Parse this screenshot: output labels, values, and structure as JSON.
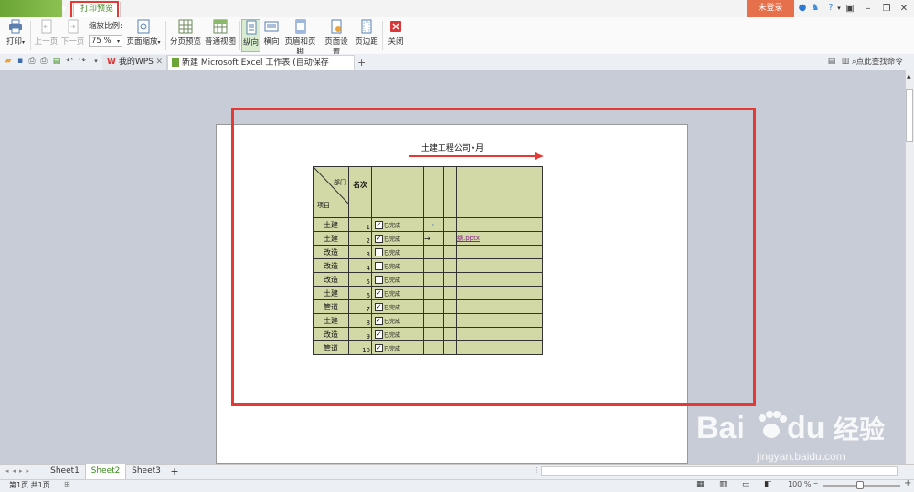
{
  "titlebar": {
    "ribbon_tab": "打印预览",
    "login": "未登录"
  },
  "ribbon": {
    "print": "打印",
    "prev_page": "上一页",
    "next_page": "下一页",
    "zoom_label": "缩放比例:",
    "zoom_value": "75 %",
    "page_zoom": "页面缩放",
    "page_break_preview": "分页预览",
    "normal_view": "普通视图",
    "portrait": "纵向",
    "landscape": "横向",
    "header_footer": "页眉和页脚",
    "page_setup": "页面设置",
    "margins": "页边距",
    "close": "关闭"
  },
  "doc_tabs": {
    "wps": "我的WPS",
    "excel": "新建 Microsoft Excel 工作表 (自动保存的).xlsx *",
    "find": "点此查找命令"
  },
  "report": {
    "title": "土建工程公司•月",
    "header_dept": "部门",
    "header_item": "项目",
    "header_rank": "名次",
    "checkbox_label": "已完成",
    "link": "纲.pptx",
    "rows": [
      {
        "item": "土建",
        "num": "1",
        "checked": true
      },
      {
        "item": "土建",
        "num": "2",
        "checked": true
      },
      {
        "item": "改造",
        "num": "3",
        "checked": false
      },
      {
        "item": "改造",
        "num": "4",
        "checked": false
      },
      {
        "item": "改造",
        "num": "5",
        "checked": false
      },
      {
        "item": "土建",
        "num": "6",
        "checked": true
      },
      {
        "item": "管道",
        "num": "7",
        "checked": true
      },
      {
        "item": "土建",
        "num": "8",
        "checked": true
      },
      {
        "item": "改造",
        "num": "9",
        "checked": true
      },
      {
        "item": "管道",
        "num": "10",
        "checked": true
      }
    ]
  },
  "sheets": {
    "s1": "Sheet1",
    "s2": "Sheet2",
    "s3": "Sheet3",
    "add": "+"
  },
  "status": {
    "page_info": "第1页 共1页",
    "zoom": "100 %"
  },
  "watermark": {
    "brand_latin": "Bai",
    "brand_latin_2": "du",
    "brand_cn": "经验",
    "url": "jingyan.baidu.com"
  },
  "colors": {
    "accent_green": "#3a8a1a",
    "highlight_red": "#e53935",
    "table_fill": "#d2d8a6",
    "login_orange": "#e5704b"
  }
}
